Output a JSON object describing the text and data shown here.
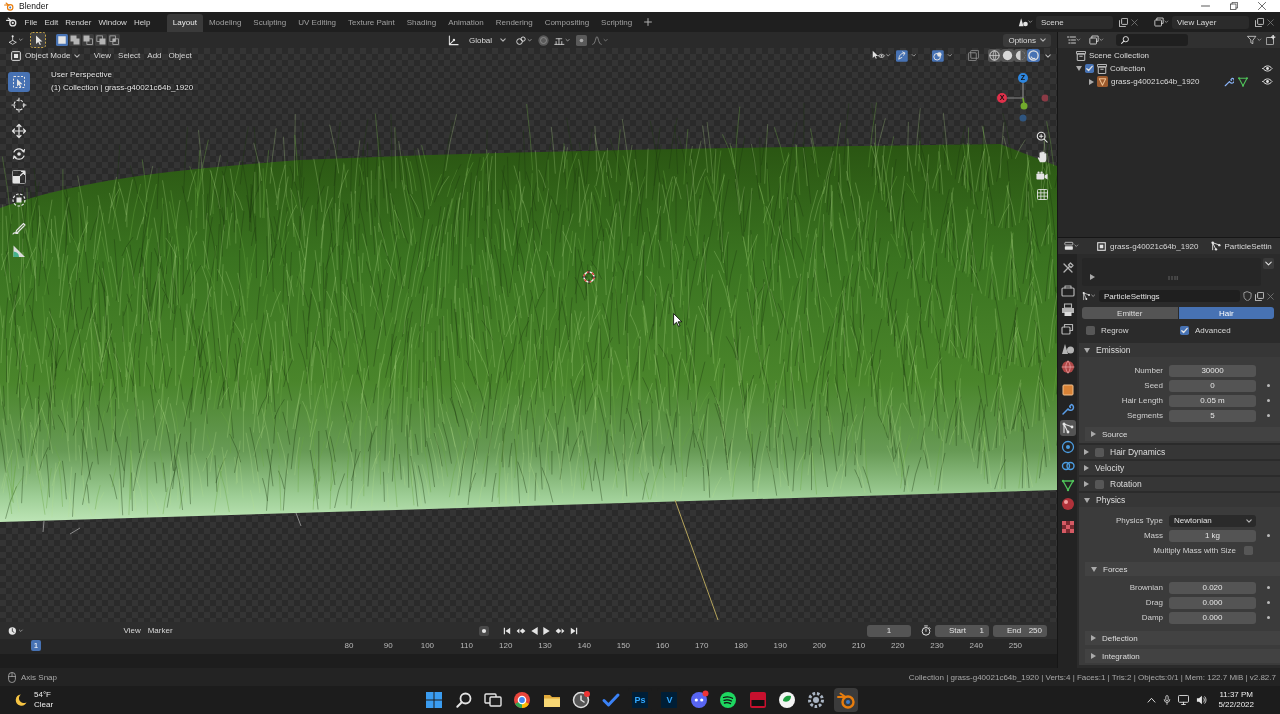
{
  "window": {
    "title": "Blender"
  },
  "menu": [
    "File",
    "Edit",
    "Render",
    "Window",
    "Help"
  ],
  "workspaces": [
    {
      "label": "Layout",
      "selected": true
    },
    {
      "label": "Modeling",
      "selected": false
    },
    {
      "label": "Sculpting",
      "selected": false
    },
    {
      "label": "UV Editing",
      "selected": false
    },
    {
      "label": "Texture Paint",
      "selected": false
    },
    {
      "label": "Shading",
      "selected": false
    },
    {
      "label": "Animation",
      "selected": false
    },
    {
      "label": "Rendering",
      "selected": false
    },
    {
      "label": "Compositing",
      "selected": false
    },
    {
      "label": "Scripting",
      "selected": false
    }
  ],
  "scene": {
    "name": "Scene"
  },
  "view_layer": {
    "name": "View Layer"
  },
  "tool_header": {
    "select_modes": [
      {
        "selected": true
      },
      {
        "selected": false
      },
      {
        "selected": false
      },
      {
        "selected": false
      },
      {
        "selected": false
      }
    ],
    "orientation": "Global",
    "options": "Options"
  },
  "viewport": {
    "mode": "Object Mode",
    "menus": [
      "View",
      "Select",
      "Add",
      "Object"
    ],
    "shading": [
      {
        "selected": false
      },
      {
        "selected": false
      },
      {
        "selected": false
      },
      {
        "selected": true
      }
    ],
    "tools": [
      {
        "selected": true
      },
      {
        "selected": false
      },
      {
        "selected": false
      },
      {
        "selected": false
      },
      {
        "selected": false
      },
      {
        "selected": false
      },
      {
        "selected": false
      },
      {
        "selected": false
      }
    ],
    "view_name": "User Perspective",
    "object_info": "(1) Collection | grass-g40021c64b_1920",
    "gizmo_axes": [
      {
        "label": "Z",
        "color": "#2e86de"
      },
      {
        "label": "X",
        "color": "#e0304a"
      }
    ]
  },
  "outliner": {
    "tree": [
      {
        "kind": "scene_collection",
        "label": "Scene Collection",
        "children": [
          {
            "kind": "collection",
            "label": "Collection",
            "expanded": true,
            "checked": true,
            "visible": true,
            "children": [
              {
                "kind": "object",
                "label": "grass-g40021c64b_1920",
                "expanded": false,
                "visible": true
              }
            ]
          }
        ]
      }
    ]
  },
  "properties": {
    "tabs": [
      {
        "selected": false
      },
      {
        "selected": false
      },
      {
        "selected": false
      },
      {
        "selected": false
      },
      {
        "selected": false
      },
      {
        "selected": false
      },
      {
        "selected": false
      },
      {
        "selected": false
      },
      {
        "selected": true
      },
      {
        "selected": false
      },
      {
        "selected": false
      },
      {
        "selected": false
      },
      {
        "selected": false
      },
      {
        "selected": false
      }
    ],
    "object_name": "grass-g40021c64b_1920",
    "data_name": "ParticleSettin",
    "settings_name": "ParticleSettings",
    "type": [
      {
        "label": "Emitter",
        "selected": false
      },
      {
        "label": "Hair",
        "selected": true
      }
    ],
    "options": [
      {
        "label": "Regrow",
        "checked": false
      },
      {
        "label": "Advanced",
        "checked": true
      }
    ],
    "panels": [
      {
        "title": "Emission",
        "expanded": true,
        "rows": [
          {
            "kind": "number",
            "label": "Number",
            "value": "30000",
            "keyable": false
          },
          {
            "kind": "number",
            "label": "Seed",
            "value": "0",
            "keyable": true
          },
          {
            "kind": "number",
            "label": "Hair Length",
            "value": "0.05 m",
            "keyable": true
          },
          {
            "kind": "number",
            "label": "Segments",
            "value": "5",
            "keyable": true
          }
        ],
        "subpanels": [
          {
            "title": "Source",
            "expanded": false
          }
        ]
      },
      {
        "title": "Hair Dynamics",
        "expanded": false,
        "checked": false
      },
      {
        "title": "Velocity",
        "expanded": false
      },
      {
        "title": "Rotation",
        "expanded": false,
        "checked": false
      },
      {
        "title": "Physics",
        "expanded": true,
        "rows": [
          {
            "kind": "dropdown",
            "label": "Physics Type",
            "value": "Newtonian"
          },
          {
            "kind": "number",
            "label": "Mass",
            "value": "1 kg",
            "keyable": true
          },
          {
            "kind": "checkbox",
            "label": "Multiply Mass with Size",
            "checked": false
          }
        ],
        "subpanels": [
          {
            "title": "Forces",
            "expanded": true,
            "rows": [
              {
                "kind": "number",
                "label": "Brownian",
                "value": "0.020",
                "keyable": true
              },
              {
                "kind": "number",
                "label": "Drag",
                "value": "0.000",
                "keyable": true
              },
              {
                "kind": "number",
                "label": "Damp",
                "value": "0.000",
                "keyable": true
              }
            ]
          },
          {
            "title": "Deflection",
            "expanded": false
          },
          {
            "title": "Integration",
            "expanded": false
          }
        ]
      }
    ]
  },
  "timeline": {
    "menus": [
      "View",
      "Marker"
    ],
    "current_frame": "1",
    "start": {
      "label": "Start",
      "value": "1"
    },
    "end": {
      "label": "End",
      "value": "250"
    },
    "playhead": "1",
    "ruler": [
      "80",
      "90",
      "100",
      "110",
      "120",
      "130",
      "140",
      "150",
      "160",
      "170",
      "180",
      "190",
      "200",
      "210",
      "220",
      "230",
      "240",
      "250"
    ]
  },
  "status_bar": {
    "hint": "Axis Snap",
    "stats": "Collection | grass-g40021c64b_1920 | Verts:4 | Faces:1 | Tris:2 | Objects:0/1 | Mem: 122.7 MiB | v2.82.7"
  },
  "taskbar": {
    "weather": {
      "temperature": "54°F",
      "condition": "Clear"
    },
    "apps": [
      {
        "active": false
      },
      {
        "active": false
      },
      {
        "active": false
      },
      {
        "active": false
      },
      {
        "active": false
      },
      {
        "active": false
      },
      {
        "active": false
      },
      {
        "label": "Ps",
        "active": false
      },
      {
        "label": "V",
        "active": false
      },
      {
        "active": false
      },
      {
        "active": false
      },
      {
        "active": false
      },
      {
        "active": false
      },
      {
        "active": false
      },
      {
        "active": true
      }
    ],
    "clock": {
      "time": "11:37 PM",
      "date": "5/22/2022"
    }
  }
}
